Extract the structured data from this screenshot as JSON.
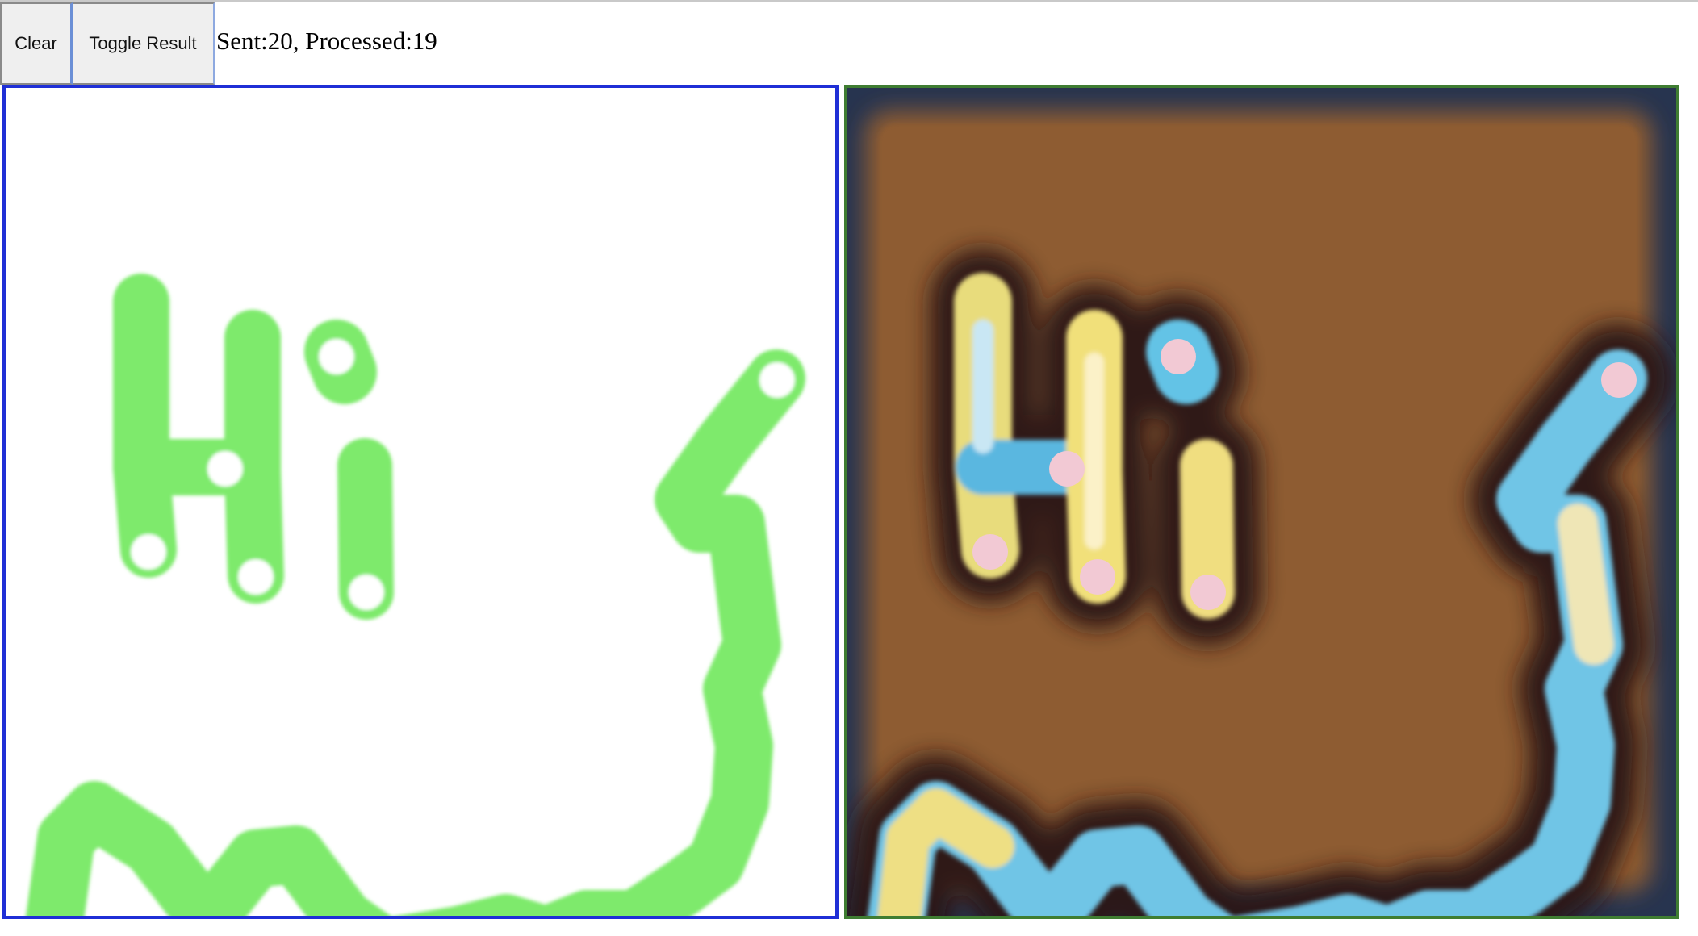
{
  "toolbar": {
    "clear_label": "Clear",
    "toggle_label": "Toggle Result",
    "status_text": "Sent:20, Processed:19"
  },
  "drawing": {
    "written_text": "Hi",
    "stroke_color": "#6ee85a",
    "border_color": "#1f2fd6"
  },
  "result": {
    "background_color": "#8c5a2e",
    "border_color": "#3f7d32",
    "accent_colors": [
      "#f2e07a",
      "#6cc6ea",
      "#2b1a1a"
    ]
  }
}
